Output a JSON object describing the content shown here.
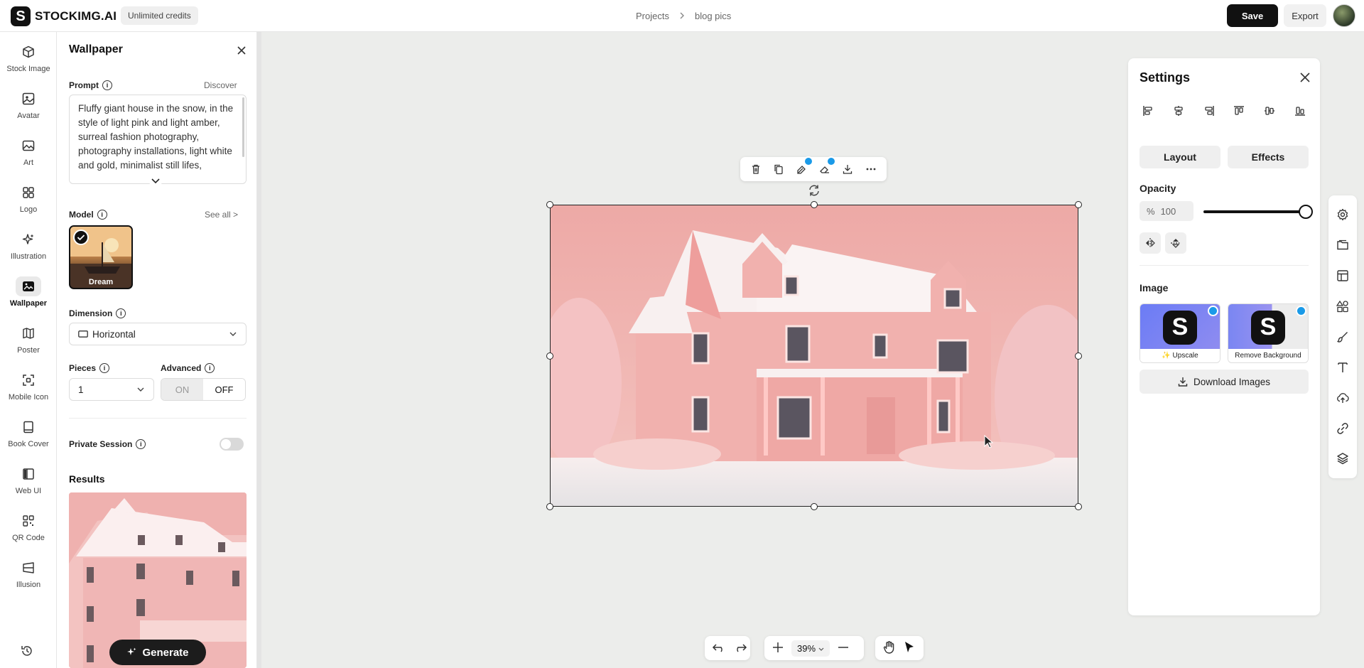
{
  "header": {
    "logo_letter": "S",
    "brand": "STOCKIMG.AI",
    "credits_badge": "Unlimited credits",
    "breadcrumb": [
      "Projects",
      "blog pics"
    ],
    "save_label": "Save",
    "export_label": "Export"
  },
  "rail": {
    "items": [
      {
        "label": "Stock Image",
        "icon": "cube-icon"
      },
      {
        "label": "Avatar",
        "icon": "image-icon"
      },
      {
        "label": "Art",
        "icon": "picture-icon"
      },
      {
        "label": "Logo",
        "icon": "grid-icon"
      },
      {
        "label": "Illustration",
        "icon": "sparkle-icon"
      },
      {
        "label": "Wallpaper",
        "icon": "wallpaper-icon",
        "active": true
      },
      {
        "label": "Poster",
        "icon": "map-icon"
      },
      {
        "label": "Mobile Icon",
        "icon": "mobile-icon"
      },
      {
        "label": "Book Cover",
        "icon": "book-icon"
      },
      {
        "label": "Web UI",
        "icon": "web-icon"
      },
      {
        "label": "QR Code",
        "icon": "qr-icon"
      },
      {
        "label": "Illusion",
        "icon": "illusion-icon"
      }
    ]
  },
  "panel": {
    "title": "Wallpaper",
    "prompt_label": "Prompt",
    "discover_label": "Discover",
    "prompt_text": "Fluffy giant house in the snow, in the style of light pink and light amber, surreal fashion photography, photography installations, light white and gold, minimalist still lifes,",
    "model_label": "Model",
    "see_all_label": "See all >",
    "model_name": "Dream",
    "dimension_label": "Dimension",
    "dimension_value": "Horizontal",
    "pieces_label": "Pieces",
    "pieces_value": "1",
    "advanced_label": "Advanced",
    "advanced_on": "ON",
    "advanced_off": "OFF",
    "private_label": "Private Session",
    "private_on": false,
    "results_label": "Results",
    "generate_label": "Generate"
  },
  "canvas": {
    "zoom": "39%"
  },
  "settings": {
    "title": "Settings",
    "tab_layout": "Layout",
    "tab_effects": "Effects",
    "opacity_label": "Opacity",
    "opacity_symbol": "%",
    "opacity_value": "100",
    "image_label": "Image",
    "upscale_label": "✨ Upscale",
    "remove_bg_label": "Remove Background",
    "download_label": "Download Images"
  },
  "colors": {
    "accent_pro": "#1a9ae8",
    "dark": "#111111",
    "pink_sky": "#eea8a7"
  }
}
